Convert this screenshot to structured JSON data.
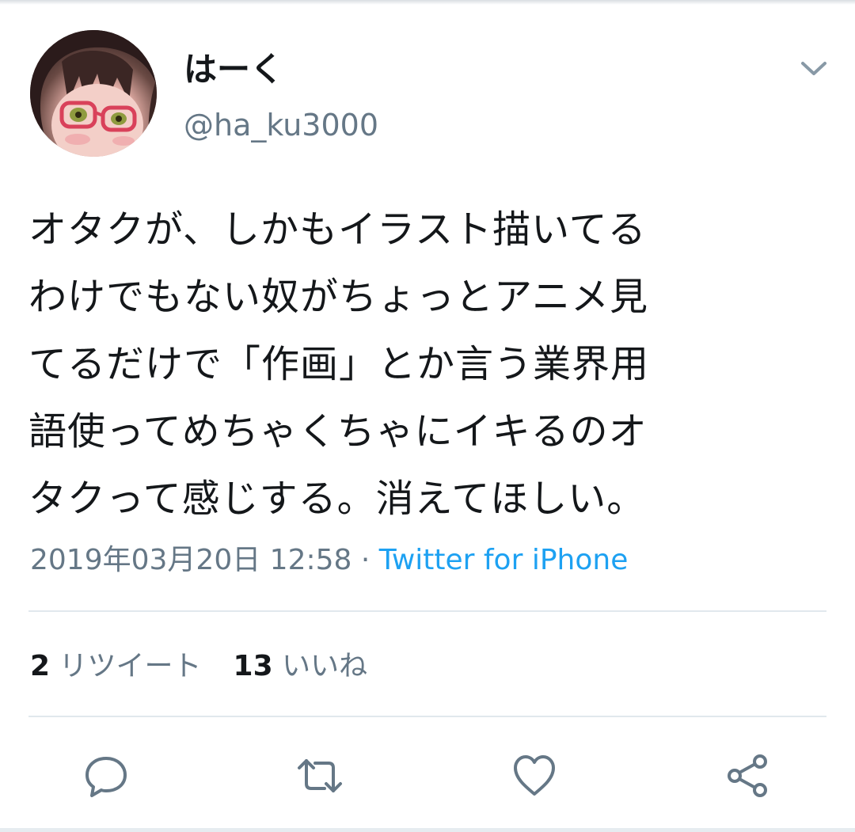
{
  "user": {
    "display_name": "はーく",
    "handle": "@ha_ku3000"
  },
  "tweet": {
    "text": "オタクが、しかもイラスト描いてる\nわけでもない奴がちょっとアニメ見\nてるだけで「作画」とか言う業界用\n語使ってめちゃくちゃにイキるのオ\nタクって感じする。消えてほしい。",
    "timestamp": "2019年03月20日 12:58",
    "separator": " · ",
    "source": "Twitter for iPhone"
  },
  "stats": {
    "retweets_count": "2",
    "retweets_label": "リツイート",
    "likes_count": "13",
    "likes_label": "いいね"
  },
  "actions": {
    "icons": [
      "reply-icon",
      "retweet-icon",
      "like-icon",
      "share-icon"
    ]
  },
  "colors": {
    "text": "#14171a",
    "secondary": "#657786",
    "accent": "#1da1f2",
    "divider": "#e1e8ed"
  }
}
